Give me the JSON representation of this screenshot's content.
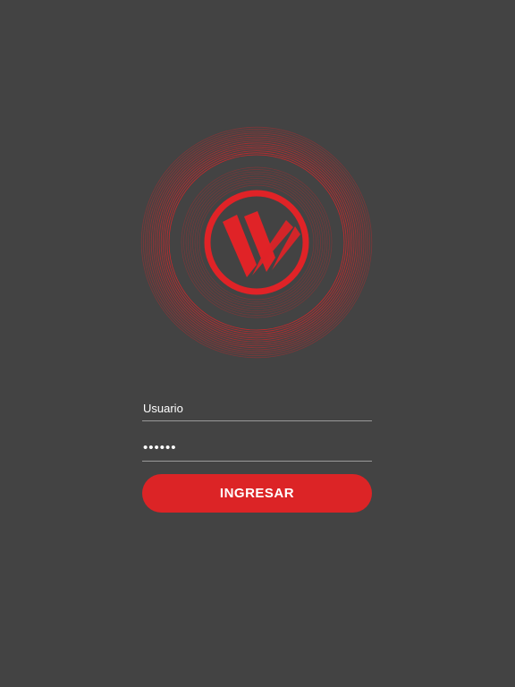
{
  "colors": {
    "background": "#434343",
    "accent": "#dc2426",
    "input_line": "#9a9a9a",
    "text": "#ffffff"
  },
  "logo": {
    "icon": "w-circle-logo-icon"
  },
  "login_form": {
    "username": {
      "placeholder": "Usuario",
      "value": ""
    },
    "password": {
      "value": "••••••"
    },
    "submit_label": "INGRESAR"
  }
}
